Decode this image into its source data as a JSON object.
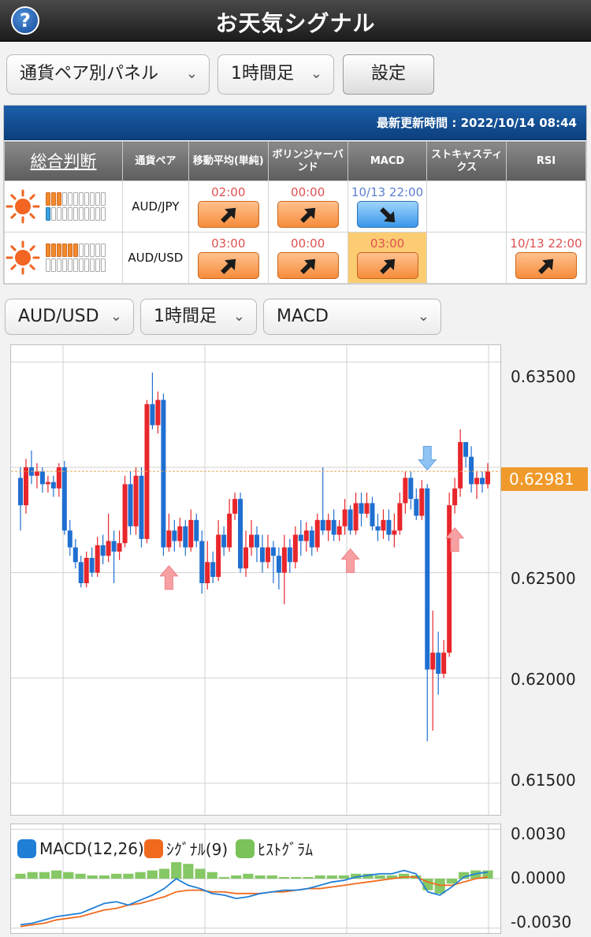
{
  "header": {
    "title": "お天気シグナル",
    "help_label": "?"
  },
  "controls": {
    "panel_select": "通貨ペア別パネル",
    "timeframe_select": "1時間足",
    "settings_label": "設定"
  },
  "panel": {
    "update_time": "最新更新時間 : 2022/10/14 08:44",
    "columns": [
      "総合判断",
      "通貨ペア",
      "移動平均(単純)",
      "ボリンジャーバンド",
      "MACD",
      "ストキャスティクス",
      "RSI"
    ],
    "rows": [
      {
        "pair": "AUD/JPY",
        "weather_icon": "sun-icon",
        "meter_top": 3,
        "meter_bottom": 1,
        "meter_total": 11,
        "signals": [
          {
            "time": "02:00",
            "direction": "up",
            "color": "#f68c3c"
          },
          {
            "time": "00:00",
            "direction": "up",
            "color": "#f68c3c"
          },
          {
            "time": "10/13 22:00",
            "direction": "down",
            "color": "#3b97e8"
          },
          null,
          null
        ]
      },
      {
        "pair": "AUD/USD",
        "weather_icon": "sun-icon",
        "meter_top": 6,
        "meter_bottom": 0,
        "meter_total": 11,
        "signals": [
          {
            "time": "03:00",
            "direction": "up",
            "color": "#f68c3c"
          },
          {
            "time": "00:00",
            "direction": "up",
            "color": "#f68c3c"
          },
          {
            "time": "03:00",
            "direction": "up",
            "color": "#f68c3c",
            "highlight": true
          },
          null,
          {
            "time": "10/13 22:00",
            "direction": "up",
            "color": "#f68c3c"
          }
        ]
      }
    ]
  },
  "chart_controls": {
    "pair_select": "AUD/USD",
    "timeframe_select": "1時間足",
    "indicator_select": "MACD"
  },
  "chart_data": [
    {
      "type": "candlestick",
      "title": "",
      "y_ticks": [
        "0.63500",
        "0.63000",
        "0.62500",
        "0.62000",
        "0.61500"
      ],
      "ylim": [
        0.6135,
        0.6358
      ],
      "current_price": "0.62981",
      "candles": [
        [
          0.6295,
          0.6282,
          0.63,
          0.627
        ],
        [
          0.6282,
          0.63,
          0.6304,
          0.6278
        ],
        [
          0.63,
          0.6296,
          0.6308,
          0.6292
        ],
        [
          0.6296,
          0.6298,
          0.6302,
          0.629
        ],
        [
          0.6298,
          0.6292,
          0.63,
          0.6288
        ],
        [
          0.6292,
          0.6293,
          0.6296,
          0.6288
        ],
        [
          0.6293,
          0.629,
          0.6296,
          0.6286
        ],
        [
          0.629,
          0.63,
          0.6302,
          0.6286
        ],
        [
          0.63,
          0.627,
          0.6303,
          0.6268
        ],
        [
          0.627,
          0.6262,
          0.6275,
          0.6258
        ],
        [
          0.6262,
          0.6255,
          0.6266,
          0.6252
        ],
        [
          0.6255,
          0.6245,
          0.6258,
          0.6243
        ],
        [
          0.6245,
          0.6257,
          0.626,
          0.6243
        ],
        [
          0.6257,
          0.625,
          0.6262,
          0.6248
        ],
        [
          0.625,
          0.6263,
          0.6267,
          0.6248
        ],
        [
          0.6263,
          0.6258,
          0.6268,
          0.6254
        ],
        [
          0.6258,
          0.6265,
          0.6278,
          0.6255
        ],
        [
          0.6265,
          0.626,
          0.627,
          0.6245
        ],
        [
          0.626,
          0.6264,
          0.627,
          0.6256
        ],
        [
          0.6264,
          0.6292,
          0.6296,
          0.6262
        ],
        [
          0.6292,
          0.6272,
          0.6298,
          0.6268
        ],
        [
          0.6272,
          0.6296,
          0.63,
          0.6268
        ],
        [
          0.6296,
          0.6266,
          0.63,
          0.6262
        ],
        [
          0.6266,
          0.633,
          0.6332,
          0.6264
        ],
        [
          0.633,
          0.632,
          0.6345,
          0.6318
        ],
        [
          0.632,
          0.6332,
          0.6336,
          0.6316
        ],
        [
          0.6332,
          0.6262,
          0.6335,
          0.6258
        ],
        [
          0.6262,
          0.627,
          0.6278,
          0.626
        ],
        [
          0.627,
          0.6265,
          0.6275,
          0.626
        ],
        [
          0.6265,
          0.6272,
          0.6276,
          0.6262
        ],
        [
          0.6272,
          0.6262,
          0.6275,
          0.6258
        ],
        [
          0.6262,
          0.6275,
          0.628,
          0.626
        ],
        [
          0.6275,
          0.6265,
          0.6278,
          0.6262
        ],
        [
          0.6265,
          0.6245,
          0.627,
          0.624
        ],
        [
          0.6245,
          0.6255,
          0.6265,
          0.6242
        ],
        [
          0.6255,
          0.6248,
          0.626,
          0.6245
        ],
        [
          0.6248,
          0.6268,
          0.6275,
          0.6246
        ],
        [
          0.6268,
          0.6262,
          0.6272,
          0.6258
        ],
        [
          0.6262,
          0.6278,
          0.6285,
          0.626
        ],
        [
          0.6278,
          0.6285,
          0.6288,
          0.6275
        ],
        [
          0.6285,
          0.6252,
          0.6288,
          0.625
        ],
        [
          0.6252,
          0.6262,
          0.627,
          0.6248
        ],
        [
          0.6262,
          0.6268,
          0.6275,
          0.6258
        ],
        [
          0.6268,
          0.6262,
          0.6272,
          0.6255
        ],
        [
          0.6262,
          0.6255,
          0.6268,
          0.625
        ],
        [
          0.6255,
          0.6262,
          0.6268,
          0.6252
        ],
        [
          0.6262,
          0.6258,
          0.6265,
          0.6245
        ],
        [
          0.6258,
          0.625,
          0.6262,
          0.6242
        ],
        [
          0.625,
          0.6262,
          0.6268,
          0.6235
        ],
        [
          0.6262,
          0.6255,
          0.6266,
          0.625
        ],
        [
          0.6255,
          0.6268,
          0.6272,
          0.6252
        ],
        [
          0.6268,
          0.6265,
          0.6275,
          0.6258
        ],
        [
          0.6265,
          0.627,
          0.6274,
          0.626
        ],
        [
          0.627,
          0.6262,
          0.6272,
          0.6258
        ],
        [
          0.6262,
          0.6275,
          0.6278,
          0.626
        ],
        [
          0.6275,
          0.627,
          0.63,
          0.6268
        ],
        [
          0.627,
          0.6275,
          0.6278,
          0.6265
        ],
        [
          0.6275,
          0.6268,
          0.628,
          0.6265
        ],
        [
          0.6268,
          0.6272,
          0.6275,
          0.6265
        ],
        [
          0.6272,
          0.628,
          0.6285,
          0.6268
        ],
        [
          0.628,
          0.627,
          0.6282,
          0.6268
        ],
        [
          0.627,
          0.6283,
          0.6288,
          0.6268
        ],
        [
          0.6283,
          0.6278,
          0.6288,
          0.6272
        ],
        [
          0.6278,
          0.6283,
          0.6288,
          0.6276
        ],
        [
          0.6283,
          0.6272,
          0.6286,
          0.627
        ],
        [
          0.6272,
          0.627,
          0.6278,
          0.6265
        ],
        [
          0.627,
          0.6275,
          0.628,
          0.6266
        ],
        [
          0.6275,
          0.6268,
          0.628,
          0.6265
        ],
        [
          0.6268,
          0.627,
          0.6278,
          0.6262
        ],
        [
          0.627,
          0.6283,
          0.6288,
          0.6268
        ],
        [
          0.6283,
          0.6295,
          0.6298,
          0.6278
        ],
        [
          0.6295,
          0.6285,
          0.6298,
          0.628
        ],
        [
          0.6285,
          0.6277,
          0.629,
          0.6275
        ],
        [
          0.6277,
          0.629,
          0.6294,
          0.6275
        ],
        [
          0.629,
          0.6204,
          0.6292,
          0.617
        ],
        [
          0.6204,
          0.6212,
          0.6232,
          0.6175
        ],
        [
          0.6212,
          0.6202,
          0.6222,
          0.6192
        ],
        [
          0.6202,
          0.6212,
          0.6218,
          0.62
        ],
        [
          0.6212,
          0.6282,
          0.6288,
          0.621
        ],
        [
          0.6282,
          0.629,
          0.6295,
          0.6278
        ],
        [
          0.629,
          0.6312,
          0.6318,
          0.6286
        ],
        [
          0.6312,
          0.6305,
          0.6312,
          0.63
        ],
        [
          0.6305,
          0.6292,
          0.631,
          0.6288
        ],
        [
          0.6292,
          0.6295,
          0.6298,
          0.6285
        ],
        [
          0.6295,
          0.6292,
          0.6298,
          0.6288
        ],
        [
          0.6292,
          0.6298,
          0.6302,
          0.629
        ]
      ],
      "signal_arrows": [
        {
          "index": 27,
          "direction": "up"
        },
        {
          "index": 60,
          "direction": "up"
        },
        {
          "index": 74,
          "direction": "down"
        },
        {
          "index": 79,
          "direction": "up"
        }
      ]
    },
    {
      "type": "line",
      "y_ticks": [
        "0.0030",
        "0.0000",
        "-0.0030"
      ],
      "ylim": [
        -0.0033,
        0.0033
      ],
      "series": [
        {
          "name": "MACD(12,26)",
          "color": "#1f7fd6",
          "values": [
            -0.0028,
            -0.0027,
            -0.0025,
            -0.0023,
            -0.0022,
            -0.0021,
            -0.0018,
            -0.0015,
            -0.0014,
            -0.0016,
            -0.0013,
            -0.001,
            -0.0006,
            0.0,
            -0.0004,
            -0.0006,
            -0.0009,
            -0.001,
            -0.0012,
            -0.0011,
            -0.0009,
            -0.0008,
            -0.0007,
            -0.0007,
            -0.0006,
            -0.0004,
            -0.0002,
            -0.0001,
            0.0001,
            0.0002,
            0.0003,
            0.0003,
            0.0005,
            0.0003,
            -0.0008,
            -0.001,
            -0.0005,
            0.0001,
            0.0003,
            0.0004
          ]
        },
        {
          "name": "ｼｸﾞﾅﾙ(9)",
          "color": "#f06a1e",
          "values": [
            -0.0029,
            -0.0028,
            -0.0027,
            -0.0025,
            -0.0024,
            -0.0023,
            -0.0021,
            -0.0019,
            -0.0018,
            -0.0016,
            -0.0015,
            -0.0013,
            -0.0011,
            -0.0008,
            -0.0007,
            -0.0007,
            -0.0008,
            -0.0008,
            -0.0009,
            -0.0009,
            -0.0009,
            -0.0008,
            -0.0008,
            -0.0007,
            -0.0006,
            -0.0006,
            -0.0005,
            -0.0004,
            -0.0003,
            -0.0002,
            -0.0001,
            0.0,
            0.0001,
            0.0001,
            -0.0002,
            -0.0004,
            -0.0004,
            -0.0002,
            0.0,
            0.0001
          ]
        },
        {
          "name": "ﾋｽﾄｸﾞﾗﾑ",
          "color": "#7cc25a",
          "values": [
            0.0003,
            0.0004,
            0.0004,
            0.0005,
            0.0004,
            0.0003,
            0.0002,
            0.0002,
            0.0003,
            0.0003,
            0.0004,
            0.0005,
            0.0006,
            0.001,
            0.0009,
            0.0006,
            0.0004,
            0.0001,
            0.0002,
            0.0003,
            0.0002,
            0.0002,
            0.0001,
            0.0001,
            0.0001,
            0.0002,
            0.0002,
            0.0002,
            0.0003,
            0.0003,
            0.0002,
            0.0002,
            0.0003,
            0.0002,
            -0.0007,
            -0.0009,
            -0.0003,
            0.0004,
            0.0005,
            0.0005
          ]
        }
      ]
    }
  ]
}
